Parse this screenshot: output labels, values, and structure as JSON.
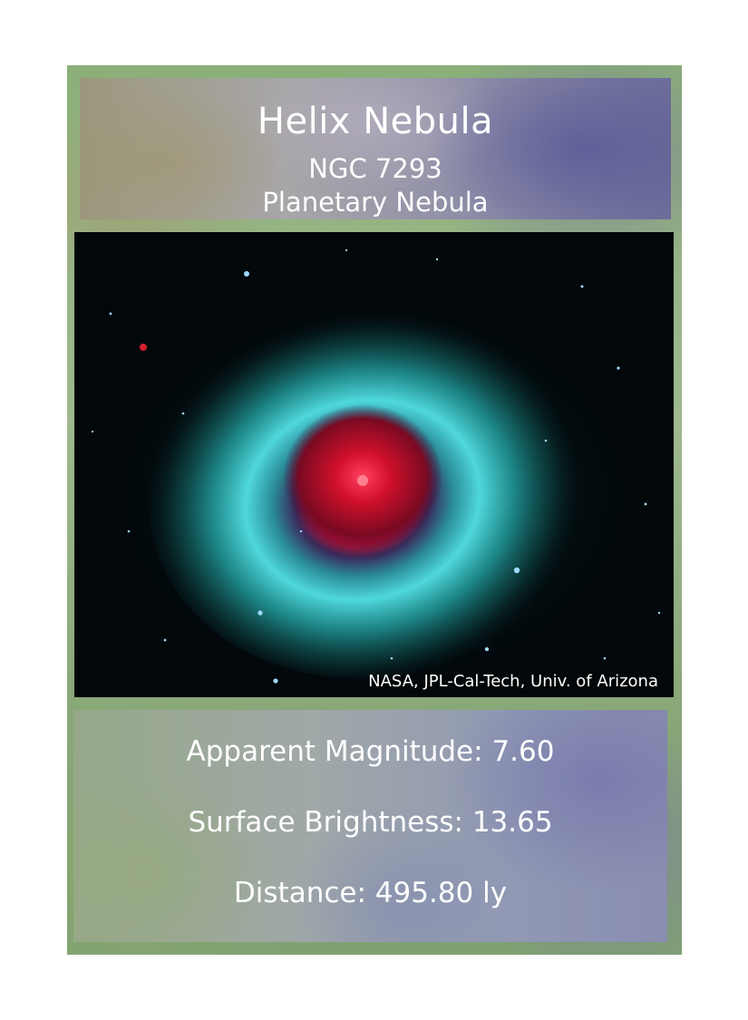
{
  "card": {
    "title": "Helix Nebula",
    "catalog_id": "NGC 7293",
    "object_type": "Planetary Nebula"
  },
  "image": {
    "subject": "helix-nebula-infrared-photo",
    "credit": "NASA, JPL-Cal-Tech, Univ. of Arizona"
  },
  "stats": {
    "apparent_magnitude": "Apparent Magnitude: 7.60",
    "surface_brightness": "Surface Brightness: 13.65",
    "distance": "Distance: 495.80 ly"
  },
  "colors": {
    "frame_green": "#8ab078",
    "nebula_cyan": "#3fd0d8",
    "nebula_core_red": "#d0102a",
    "space_black": "#02070a",
    "text": "#ffffff"
  }
}
